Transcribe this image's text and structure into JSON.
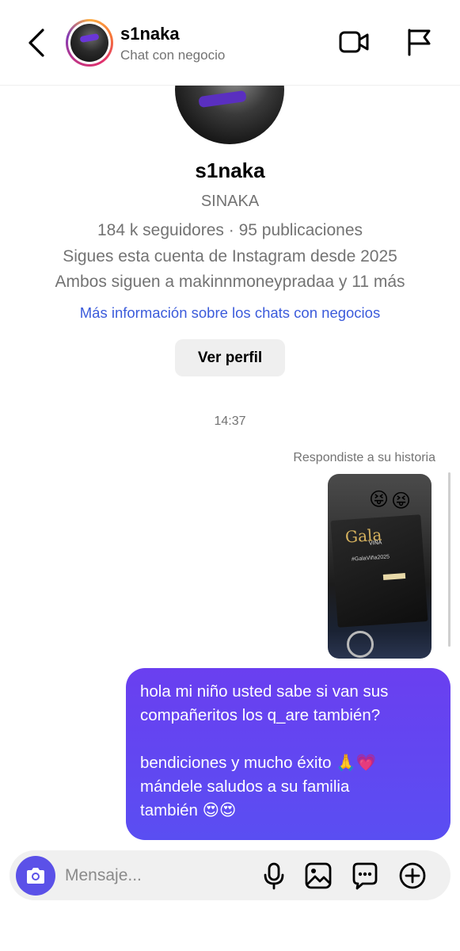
{
  "header": {
    "name": "s1naka",
    "subtitle": "Chat con negocio"
  },
  "profile": {
    "username": "s1naka",
    "full_name": "SINAKA",
    "stats": "184 k seguidores · 95 publicaciones",
    "following_since": "Sigues esta cuenta de Instagram desde 2025",
    "mutual": "Ambos siguen a makinnmoneypradaa y 11 más",
    "info_link": "Más información sobre los chats con negocios",
    "view_profile_label": "Ver perfil"
  },
  "chat": {
    "timestamp": "14:37",
    "reply_note": "Respondiste a su historia",
    "story": {
      "emojis": [
        "😝",
        "😝"
      ],
      "box_title": "Gala",
      "box_subtitle": "VIÑA",
      "box_tag": "#GalaViña2025"
    },
    "message": {
      "paragraph1": "hola mi niño usted sabe si van sus compañeritos los q_are también?",
      "paragraph2_line1": "bendiciones y mucho éxito 🙏💗",
      "paragraph2_line2": "mándele saludos a su familia",
      "paragraph2_line3": "también 😍😍"
    }
  },
  "composer": {
    "placeholder": "Mensaje..."
  },
  "colors": {
    "bubble": "#5b47f0",
    "link": "#3b5bdb",
    "camera_button": "#5b51e8",
    "secondary_text": "#737373"
  }
}
